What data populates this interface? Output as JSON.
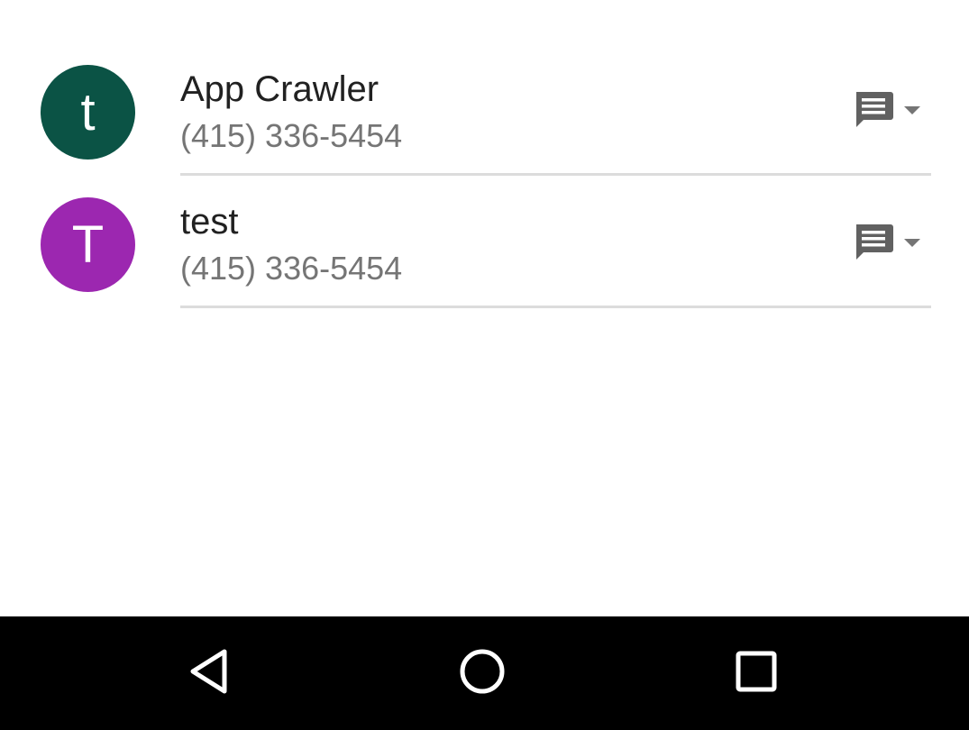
{
  "contacts_list": {
    "section_header": "",
    "contacts": [
      {
        "avatar_letter": "t",
        "avatar_color": "#0b5345",
        "name": "App Crawler",
        "phone": "(415) 336-5454",
        "action_icon": "message-icon",
        "dropdown_icon": "caret-down-icon"
      },
      {
        "avatar_letter": "T",
        "avatar_color": "#9c27b0",
        "name": "test",
        "phone": "(415) 336-5454",
        "action_icon": "message-icon",
        "dropdown_icon": "caret-down-icon"
      }
    ]
  },
  "nav_bar": {
    "background": "#000000",
    "buttons": [
      "back-icon",
      "home-icon",
      "recents-icon"
    ]
  }
}
